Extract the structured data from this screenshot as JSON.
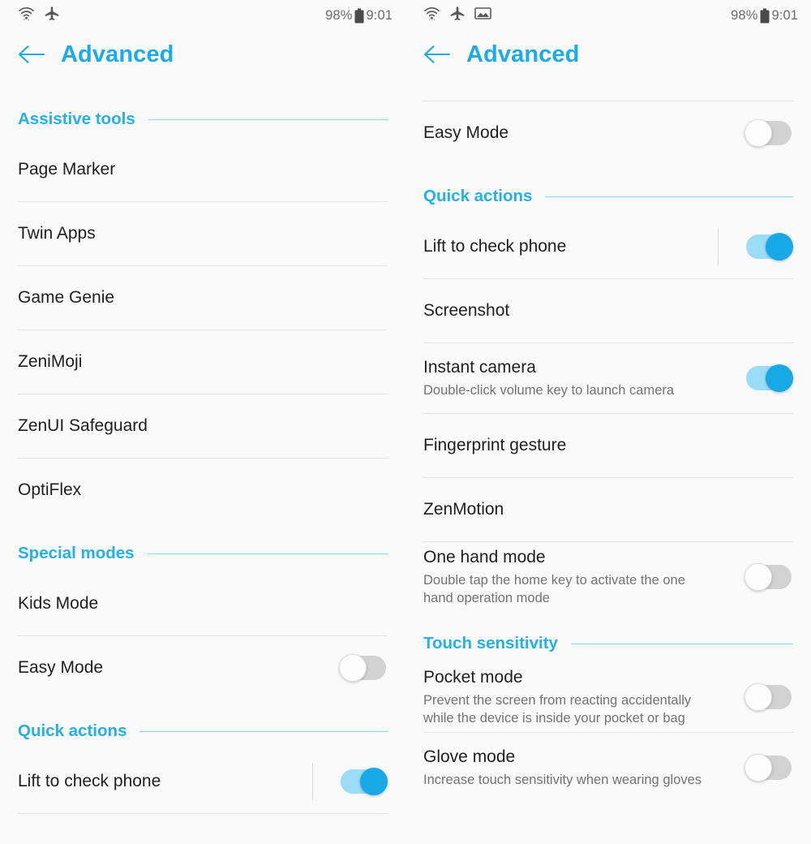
{
  "status_bar": {
    "battery_percent": "98%",
    "time": "9:01",
    "icons_left_panel": [
      "wifi-icon",
      "airplane-mode-icon"
    ],
    "icons_right_panel": [
      "wifi-icon",
      "airplane-mode-icon",
      "screenshot-image-icon"
    ],
    "battery_icon": "battery-icon"
  },
  "header": {
    "title": "Advanced",
    "back_icon": "back-arrow-icon",
    "accent_color": "#1cabe8"
  },
  "left_panel": {
    "sections": [
      {
        "title": "Assistive tools",
        "rows": [
          {
            "label": "Page Marker",
            "sub": "",
            "toggle": null,
            "divider_below": true
          },
          {
            "label": "Twin Apps",
            "sub": "",
            "toggle": null,
            "divider_below": true
          },
          {
            "label": "Game Genie",
            "sub": "",
            "toggle": null,
            "divider_below": true
          },
          {
            "label": "ZeniMoji",
            "sub": "",
            "toggle": null,
            "divider_below": true
          },
          {
            "label": "ZenUI Safeguard",
            "sub": "",
            "toggle": null,
            "divider_below": true
          },
          {
            "label": "OptiFlex",
            "sub": "",
            "toggle": null,
            "divider_below": false
          }
        ]
      },
      {
        "title": "Special modes",
        "rows": [
          {
            "label": "Kids Mode",
            "sub": "",
            "toggle": null,
            "divider_below": true
          },
          {
            "label": "Easy Mode",
            "sub": "",
            "toggle": "off",
            "divider_below": false
          }
        ]
      },
      {
        "title": "Quick actions",
        "rows": [
          {
            "label": "Lift to check phone",
            "sub": "",
            "toggle": "on",
            "divider_below": true
          }
        ]
      }
    ]
  },
  "right_panel": {
    "top_divider": true,
    "sections": [
      {
        "title": "",
        "rows": [
          {
            "label": "Easy Mode",
            "sub": "",
            "toggle": "off",
            "divider_below": false
          }
        ]
      },
      {
        "title": "Quick actions",
        "rows": [
          {
            "label": "Lift to check phone",
            "sub": "",
            "toggle": "on",
            "divider_below": true
          },
          {
            "label": "Screenshot",
            "sub": "",
            "toggle": null,
            "divider_below": true
          },
          {
            "label": "Instant camera",
            "sub": "Double-click volume key to launch camera",
            "toggle": "on",
            "divider_below": true
          },
          {
            "label": "Fingerprint gesture",
            "sub": "",
            "toggle": null,
            "divider_below": true
          },
          {
            "label": "ZenMotion",
            "sub": "",
            "toggle": null,
            "divider_below": true
          },
          {
            "label": "One hand mode",
            "sub": "Double tap the home key to activate the one hand operation mode",
            "toggle": "off",
            "divider_below": false
          }
        ]
      },
      {
        "title": "Touch sensitivity",
        "rows": [
          {
            "label": "Pocket mode",
            "sub": "Prevent the screen from reacting accidentally while the device is inside your pocket or bag",
            "toggle": "off",
            "divider_below": true
          },
          {
            "label": "Glove mode",
            "sub": "Increase touch sensitivity when wearing gloves",
            "toggle": "off",
            "divider_below": false
          }
        ]
      }
    ]
  },
  "colors": {
    "accent": "#1cabe8",
    "section_rule": "#8fd6f0",
    "toggle_on_track": "#9bdcf7",
    "toggle_on_knob": "#17a9e6",
    "toggle_off_track": "#d2d2d2",
    "divider": "#e3e3e3",
    "background": "#fafafa"
  }
}
